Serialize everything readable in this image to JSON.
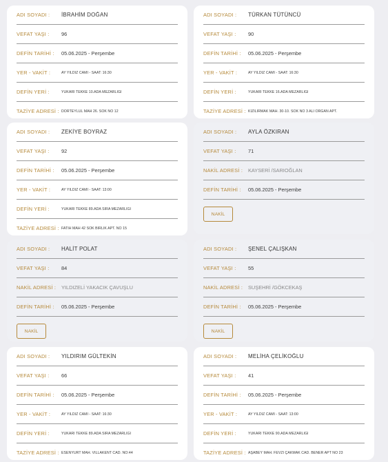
{
  "labels": {
    "name": "ADI SOYADI :",
    "age": "VEFAT YAŞI :",
    "burial_date": "DEFİN TARİHİ :",
    "place_time": "YER - VAKİT :",
    "burial_place": "DEFİN YERİ :",
    "condolence": "TAZİYE ADRESİ :",
    "transfer": "NAKİL ADRESİ :"
  },
  "nakil_button": "NAKİL",
  "cards": [
    {
      "name": "İBRAHİM DOĞAN",
      "age": "96",
      "date": "05.06.2025 - Perşembe",
      "place_time": "AY YILDIZ CAMİ - SAAT: 16:30",
      "burial_place": "YUKARI TEKKE 10.ADA MEZARLIĞI",
      "condolence": "DÖRTEYLÜL MAH 26. SOK NO 12"
    },
    {
      "name": "TÜRKAN TÜTÜNCÜ",
      "age": "90",
      "date": "05.06.2025 - Perşembe",
      "place_time": "AY YILDIZ CAMİ - SAAT: 16:30",
      "burial_place": "YUKARI TEKKE 16.ADA MEZARLIĞI",
      "condolence": "KIZILIRMAK MAH. 30-10. SOK NO 3 ALİ ORGAN APT."
    },
    {
      "name": "ZEKİYE BOYRAZ",
      "age": "92",
      "date": "05.06.2025 - Perşembe",
      "place_time": "AY YILDIZ CAMİ - SAAT: 13:00",
      "burial_place": "YUKARI TEKKE 89.ADA SIRA MEZARLIĞI",
      "condolence": "FATİH MAH 42 SOK BİRLİK APT. NO 15"
    },
    {
      "name": "AYLA ÖZKIRAN",
      "age": "71",
      "transfer": "KAYSERİ /SARIOĞLAN",
      "date": "05.06.2025 - Perşembe"
    },
    {
      "name": "HALİT POLAT",
      "age": "84",
      "transfer": "YILDIZELİ YAKACIK ÇAVUŞLU",
      "date": "05.06.2025 - Perşembe"
    },
    {
      "name": "ŞENEL ÇALIŞKAN",
      "age": "55",
      "transfer": "SUŞEHRİ /GÖKCEKAŞ",
      "date": "05.06.2025 - Perşembe"
    },
    {
      "name": "YILDIRIM GÜLTEKİN",
      "age": "66",
      "date": "05.06.2025 - Perşembe",
      "place_time": "AY YILDIZ CAMİ - SAAT: 16:30",
      "burial_place": "YUKARI TEKKE 89.ADA SIRA MEZARLIĞI",
      "condolence": "ESENYURT MAH. VİLLAKENT CAD. NO:44"
    },
    {
      "name": "MELİHA ÇELİKOĞLU",
      "age": "41",
      "date": "05.06.2025 - Perşembe",
      "place_time": "AY YILDIZ CAMİ - SAAT: 13:00",
      "burial_place": "YUKARI TEKKE 90.ADA MEZARLIĞI",
      "condolence": "AŞABEY MAH. FEVZİ ÇAKMAK CAD. BENER APT NO 23"
    }
  ]
}
